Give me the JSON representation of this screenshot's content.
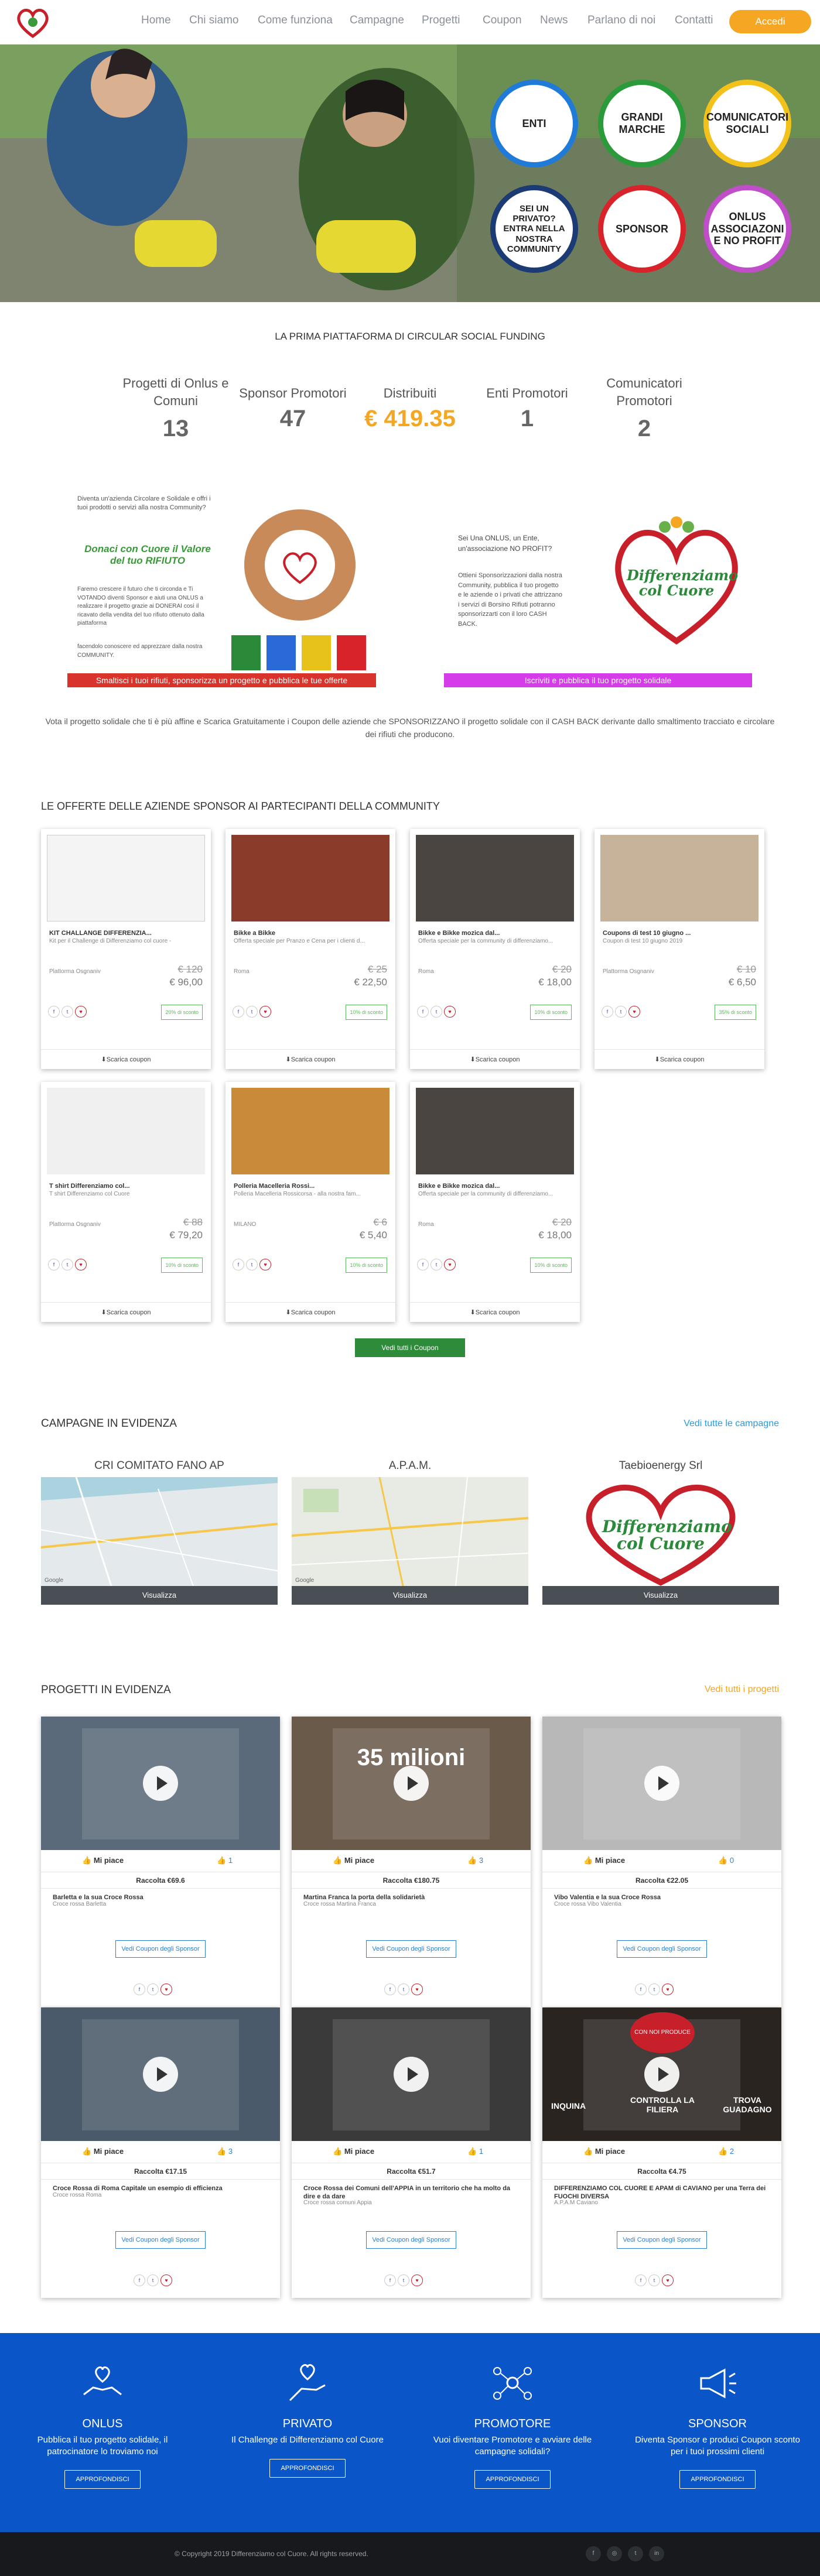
{
  "nav": {
    "links": [
      "Home",
      "Chi siamo",
      "Come funziona",
      "Campagne",
      "Progetti",
      "Coupon",
      "News",
      "Parlano di noi",
      "Contatti"
    ],
    "login": "Accedi"
  },
  "hero": {
    "circles": [
      "ENTI",
      "GRANDI MARCHE",
      "COMUNICATORI SOCIALI",
      "SEI UN PRIVATO? ENTRA NELLA NOSTRA COMMUNITY",
      "SPONSOR",
      "ONLUS ASSOCIAZONI E NO PROFIT"
    ],
    "circle_colors": [
      "#1f7ad8",
      "#2a9a3a",
      "#f2c21a",
      "#1c3a73",
      "#d8232a",
      "#c04ec8"
    ]
  },
  "platform": {
    "heading": "LA PRIMA PIATTAFORMA DI CIRCULAR SOCIAL FUNDING",
    "stats": [
      {
        "label": "Progetti di Onlus e Comuni",
        "value": "13"
      },
      {
        "label": "Sponsor Promotori",
        "value": "47"
      },
      {
        "label": "Distribuiti",
        "value": "€ 419.35"
      },
      {
        "label": "Enti Promotori",
        "value": "1"
      },
      {
        "label": "Comunicatori Promotori",
        "value": "2"
      }
    ]
  },
  "promo": {
    "left_text1": "Diventa un'azienda Circolare e Solidale e offri i tuoi prodotti o servizi alla nostra Community?",
    "left_banner_title": "Donaci con Cuore il Valore del tuo RIFIUTO",
    "left_text2": "Faremo crescere il futuro che ti circonda e Ti VOTANDO diventi Sponsor e aiuti una ONLUS a realizzare il progetto grazie ai DONERAI così il ricavato della vendita del tuo rifiuto ottenuto dalla piattaforma",
    "left_text3": "facendolo conoscere ed apprezzare dalla nostra COMMUNITY.",
    "left_button": "Smaltisci i tuoi rifiuti, sponsorizza un progetto e pubblica le tue offerte",
    "right_text1": "Sei Una ONLUS, un Ente, un'associazione NO PROFIT?",
    "right_text2": "Ottieni Sponsorizzazioni dalla nostra Community, pubblica il tuo progetto e le aziende o i privati che attrizzano i servizi di Borsino Rifiuti potranno sponsorizzarti con il loro CASH BACK.",
    "right_button": "Iscriviti e pubblica il tuo progetto solidale",
    "logo_text": "Differenziamo col Cuore",
    "vote_text": "Vota il progetto solidale che ti è più affine e Scarica Gratuitamente i Coupon delle aziende che SPONSORIZZANO il progetto solidale con il CASH BACK derivante dallo smaltimento tracciato e circolare dei rifiuti che producono."
  },
  "offers": {
    "heading": "LE OFFERTE DELLE AZIENDE SPONSOR AI PARTECIPANTI DELLA COMMUNITY",
    "download": "Scarica coupon",
    "view_all": "Vedi tutti i Coupon",
    "items": [
      {
        "title": "KIT CHALLANGE DIFFERENZIA...",
        "desc": "Kit per il Challenge di Differenziamo col cuore -",
        "loc": "Plattorma Osgnaniv",
        "old": "€ 120",
        "new": "€ 96,00",
        "disc": "20% di sconto",
        "img": "#f4f4f4"
      },
      {
        "title": "Bikke a Bikke",
        "desc": "Offerta speciale per Pranzo e Cena per i clienti d...",
        "loc": "Roma",
        "old": "€ 25",
        "new": "€ 22,50",
        "disc": "10% di sconto",
        "img": "#8a3b2a"
      },
      {
        "title": "Bikke e Bikke mozica dal...",
        "desc": "Offerta speciale per la community di differenziamo...",
        "loc": "Roma",
        "old": "€ 20",
        "new": "€ 18,00",
        "disc": "10% di sconto",
        "img": "#4a4540"
      },
      {
        "title": "Coupons di test 10 giugno ...",
        "desc": "Coupon di test 10 giugno 2019",
        "loc": "Plattorma Osgnaniv",
        "old": "€ 10",
        "new": "€ 6,50",
        "disc": "35% di sconto",
        "img": "#c7b39a"
      },
      {
        "title": "T shirt Differenziamo col...",
        "desc": "T shirt Differenziamo col Cuore",
        "loc": "Plattorma Osgnaniv",
        "old": "€ 88",
        "new": "€ 79,20",
        "disc": "10% di sconto",
        "img": "#f0f0f0"
      },
      {
        "title": "Polleria Macelleria Rossi...",
        "desc": "Polleria Macelleria Rossicorsa - alla nostra fam...",
        "loc": "MILANO",
        "old": "€ 6",
        "new": "€ 5,40",
        "disc": "10% di sconto",
        "img": "#c98a3a"
      },
      {
        "title": "Bikke e Bikke mozica dal...",
        "desc": "Offerta speciale per la community di differenziamo...",
        "loc": "Roma",
        "old": "€ 20",
        "new": "€ 18,00",
        "disc": "10% di sconto",
        "img": "#4a4540"
      }
    ]
  },
  "campaigns": {
    "heading": "CAMPAGNE IN EVIDENZA",
    "link": "Vedi tutte le campagne",
    "button": "Visualizza",
    "items": [
      {
        "name": "CRI COMITATO FANO AP"
      },
      {
        "name": "A.P.A.M."
      },
      {
        "name": "Taebioenergy Srl"
      }
    ],
    "google": "Google"
  },
  "projects": {
    "heading": "PROGETTI IN EVIDENZA",
    "link": "Vedi tutti i progetti",
    "like": "Mi piace",
    "button": "Vedi Coupon degli Sponsor",
    "items": [
      {
        "likes": "1",
        "raccolta": "Raccolta €69.6",
        "title": "Barletta e la sua Croce Rossa",
        "desc": "Croce rossa Barletta",
        "bg": "#5a6a7a"
      },
      {
        "likes": "3",
        "raccolta": "Raccolta €180.75",
        "title": "Martina Franca la porta della solidarietà",
        "desc": "Croce rossa Martina Franca",
        "bg": "#6a5a4a"
      },
      {
        "likes": "0",
        "raccolta": "Raccolta €22.05",
        "title": "Vibo Valentia e la sua Croce Rossa",
        "desc": "Croce rossa Vibo Valentia",
        "bg": "#b8b8b8"
      },
      {
        "likes": "3",
        "raccolta": "Raccolta €17.15",
        "title": "Croce Rossa di Roma Capitale un esempio di efficienza",
        "desc": "Croce rossa Roma",
        "bg": "#4a5a6a"
      },
      {
        "likes": "1",
        "raccolta": "Raccolta €51.7",
        "title": "Croce Rossa dei Comuni dell'APPIA in un territorio che ha molto da dire e da dare",
        "desc": "Croce rossa comuni Appia",
        "bg": "#3a3a3a"
      },
      {
        "likes": "2",
        "raccolta": "Raccolta €4.75",
        "title": "DIFFERENZIAMO COL CUORE E APAM di CAVIANO per una Terra dei FUOCHI DIVERSA",
        "desc": "A.P.A.M Caviano",
        "bg": "#2a2420"
      }
    ],
    "video2_text": "35 milioni",
    "video6_words": [
      "CON NOI PRODUCE",
      "CONTROLLA LA FILIERA",
      "TROVA GUADAGNO",
      "INQUINA"
    ]
  },
  "footer": {
    "cols": [
      {
        "title": "ONLUS",
        "desc": "Pubblica il tuo progetto solidale, il patrocinatore lo troviamo noi",
        "btn": "APPROFONDISCI"
      },
      {
        "title": "PRIVATO",
        "desc": "Il Challenge di Differenziamo col Cuore",
        "btn": "APPROFONDISCI"
      },
      {
        "title": "PROMOTORE",
        "desc": "Vuoi diventare Promotore e avviare delle campagne solidali?",
        "btn": "APPROFONDISCI"
      },
      {
        "title": "SPONSOR",
        "desc": "Diventa Sponsor e produci Coupon sconto per i tuoi prossimi clienti",
        "btn": "APPROFONDISCI"
      }
    ],
    "copyright": "© Copyright 2019 Differenziamo col Cuore. All rights reserved."
  },
  "colors": {
    "accent": "#f5a623",
    "footer": "#0a55c8",
    "red_button": "#d9342b",
    "magenta_button": "#d53be8",
    "green_button": "#2e8b3a",
    "link": "#f5a623"
  }
}
